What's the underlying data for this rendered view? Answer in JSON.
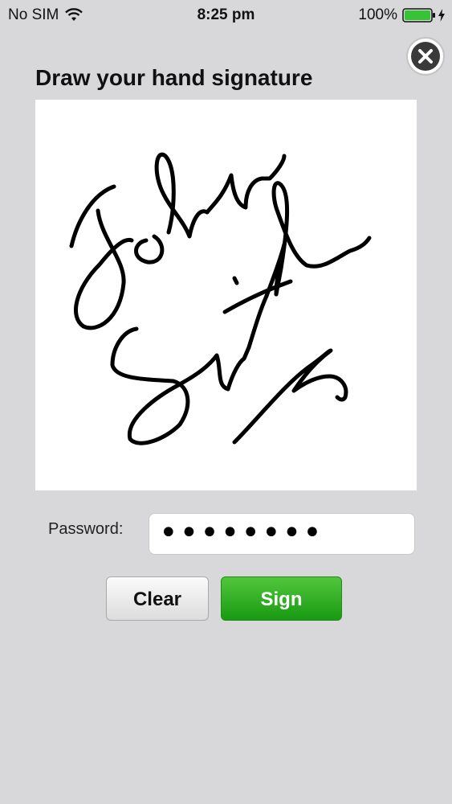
{
  "status_bar": {
    "carrier": "No SIM",
    "time": "8:25 pm",
    "battery": "100%"
  },
  "title": "Draw your hand signature",
  "signature": {
    "image_text": "John Smith"
  },
  "password": {
    "label": "Password:",
    "value": "••••••••"
  },
  "buttons": {
    "clear": "Clear",
    "sign": "Sign"
  },
  "colors": {
    "background": "#d8d8da",
    "sign_button": "#22a31a",
    "battery_fill": "#37c336"
  }
}
